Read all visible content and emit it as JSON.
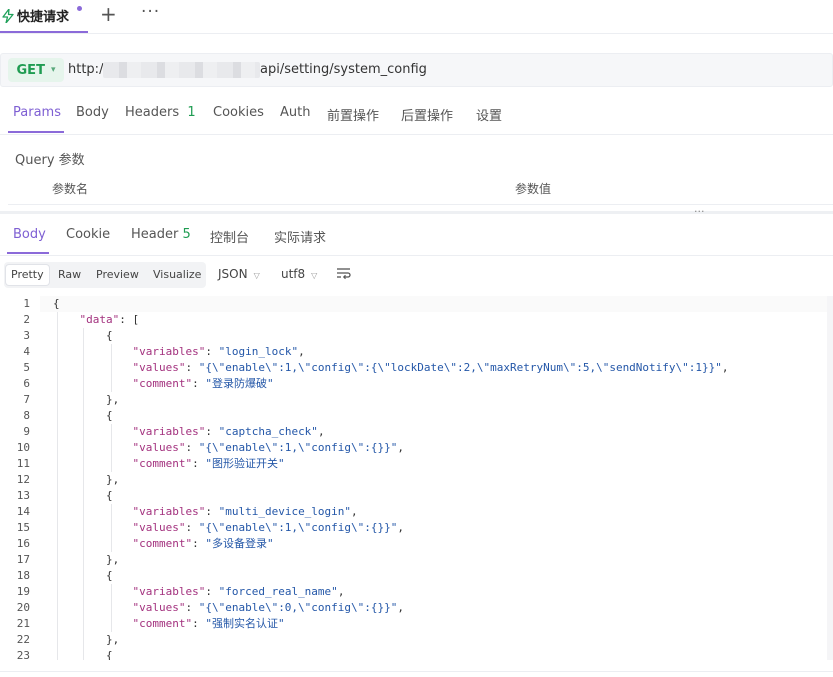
{
  "tabbar": {
    "active_tab": "快捷请求",
    "add_icon": "plus-icon",
    "more_icon": "ellipsis-icon",
    "accent": "#8b6ad9"
  },
  "request": {
    "method": "GET",
    "url_prefix": "http://",
    "url_path": "api/setting/system_config"
  },
  "request_tabs": [
    {
      "label": "Params"
    },
    {
      "label": "Body"
    },
    {
      "label": "Headers",
      "count": "1"
    },
    {
      "label": "Cookies"
    },
    {
      "label": "Auth"
    },
    {
      "label": "前置操作"
    },
    {
      "label": "后置操作"
    },
    {
      "label": "设置"
    }
  ],
  "query": {
    "title": "Query 参数",
    "col_name": "参数名",
    "col_value": "参数值"
  },
  "response_tabs": [
    {
      "label": "Body"
    },
    {
      "label": "Cookie"
    },
    {
      "label": "Header",
      "count": "5"
    },
    {
      "label": "控制台"
    },
    {
      "label": "实际请求"
    }
  ],
  "view_modes": [
    "Pretty",
    "Raw",
    "Preview",
    "Visualize"
  ],
  "format_select": "JSON",
  "encoding_select": "utf8",
  "code_lines": [
    {
      "n": "1",
      "text": "{"
    },
    {
      "n": "2",
      "text": "    \"data\": ["
    },
    {
      "n": "3",
      "text": "        {"
    },
    {
      "n": "4",
      "text": "            \"variables\": \"login_lock\","
    },
    {
      "n": "5",
      "text": "            \"values\": \"{\\\"enable\\\":1,\\\"config\\\":{\\\"lockDate\\\":2,\\\"maxRetryNum\\\":5,\\\"sendNotify\\\":1}}\","
    },
    {
      "n": "6",
      "text": "            \"comment\": \"登录防爆破\""
    },
    {
      "n": "7",
      "text": "        },"
    },
    {
      "n": "8",
      "text": "        {"
    },
    {
      "n": "9",
      "text": "            \"variables\": \"captcha_check\","
    },
    {
      "n": "10",
      "text": "            \"values\": \"{\\\"enable\\\":1,\\\"config\\\":{}}\","
    },
    {
      "n": "11",
      "text": "            \"comment\": \"图形验证开关\""
    },
    {
      "n": "12",
      "text": "        },"
    },
    {
      "n": "13",
      "text": "        {"
    },
    {
      "n": "14",
      "text": "            \"variables\": \"multi_device_login\","
    },
    {
      "n": "15",
      "text": "            \"values\": \"{\\\"enable\\\":1,\\\"config\\\":{}}\","
    },
    {
      "n": "16",
      "text": "            \"comment\": \"多设备登录\""
    },
    {
      "n": "17",
      "text": "        },"
    },
    {
      "n": "18",
      "text": "        {"
    },
    {
      "n": "19",
      "text": "            \"variables\": \"forced_real_name\","
    },
    {
      "n": "20",
      "text": "            \"values\": \"{\\\"enable\\\":0,\\\"config\\\":{}}\","
    },
    {
      "n": "21",
      "text": "            \"comment\": \"强制实名认证\""
    },
    {
      "n": "22",
      "text": "        },"
    },
    {
      "n": "23",
      "text": "        {"
    }
  ]
}
